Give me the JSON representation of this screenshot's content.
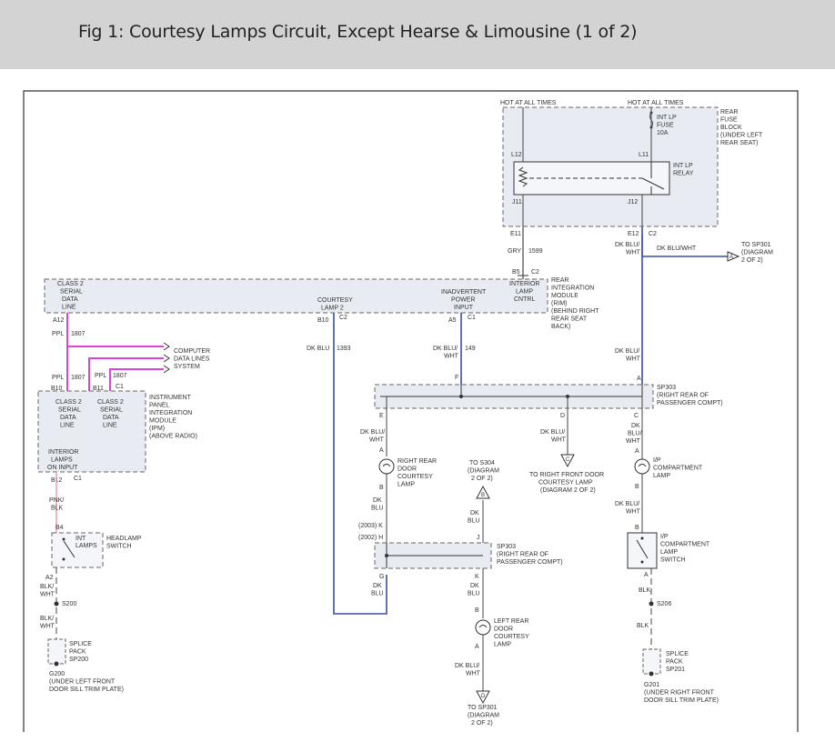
{
  "header": {
    "title": "Fig 1: Courtesy Lamps Circuit, Except Hearse & Limousine (1 of 2)"
  },
  "colors": {
    "gray_wire": "#444444",
    "blue_wire": "#3a4fa0",
    "magenta_wire": "#e040e0",
    "pink_wire": "#f0a0b0",
    "module_fill": "#e8ecf2",
    "frame": "#333333"
  },
  "fuse_block": {
    "hot_left": "HOT AT ALL TIMES",
    "hot_right": "HOT AT ALL TIMES",
    "fuse_label": [
      "INT LP",
      "FUSE",
      "10A"
    ],
    "block_label": [
      "REAR",
      "FUSE",
      "BLOCK",
      "(UNDER LEFT",
      "REAR SEAT)"
    ],
    "relay_label": [
      "INT LP",
      "RELAY"
    ],
    "pins": {
      "l12": "L12",
      "l11": "L11",
      "j11": "J11",
      "j12": "J12",
      "e11": "E11",
      "e12": "E12",
      "c2": "C2"
    }
  },
  "wires": {
    "w1599_color": "GRY",
    "w1599_num": "1599",
    "to_sp301_wire": "DK BLU/WHT",
    "to_sp301": [
      "TO SP301",
      "(DIAGRAM",
      "2 OF 2)"
    ],
    "dkbluwht_a": [
      "DK BLU/",
      "WHT"
    ],
    "w1393_color": "DK BLU",
    "w1393_num": "1393",
    "w149_color": [
      "DK BLU/",
      "WHT"
    ],
    "w149_num": "149",
    "w1807_color": "PPL",
    "w1807_num": "1807",
    "w1807b_color": "PPL",
    "w1807b_num": "1807",
    "w1807c_color": "PPL",
    "w1807c_num": "1807",
    "pnkblk": [
      "PNK/",
      "BLK"
    ],
    "blkwht1": [
      "BLK/",
      "WHT"
    ],
    "blkwht2": [
      "BLK/",
      "WHT"
    ],
    "blk1": "BLK",
    "blk2": "BLK",
    "dkblu1": [
      "DK",
      "BLU"
    ],
    "dkblu2": [
      "DK",
      "BLU"
    ],
    "dkblu3": [
      "DK",
      "BLU"
    ],
    "dkblu4": [
      "DK",
      "BLU"
    ],
    "dkbluwht_c": [
      "DK",
      "BLU/",
      "WHT"
    ],
    "dkbluwht_d": [
      "DK BLU/",
      "WHT"
    ],
    "dkbluwht_e": [
      "DK BLU/",
      "WHT"
    ],
    "dkbluwht_f": [
      "DK BLU/",
      "WHT"
    ],
    "dkbluwht_g": [
      "DK BLU/",
      "WHT"
    ]
  },
  "rim": {
    "b5": "B5",
    "c2": "C2",
    "label": [
      "REAR",
      "INTEGRATION",
      "MODULE",
      "(RIM)",
      "(BEHIND RIGHT",
      "REAR SEAT",
      "BACK)"
    ],
    "class2": [
      "CLASS 2",
      "SERIAL",
      "DATA",
      "LINE"
    ],
    "courtesy": [
      "COURTESY",
      "LAMP 2"
    ],
    "inadvertent": [
      "INADVERTENT",
      "POWER",
      "INPUT"
    ],
    "interior": [
      "INTERIOR",
      "LAMP",
      "CNTRL"
    ],
    "a12": "A12",
    "b10": "B10",
    "c2b": "C2",
    "a5": "A5",
    "c1": "C1"
  },
  "computer": [
    "COMPUTER",
    "DATA LINES",
    "SYSTEM"
  ],
  "ipm": {
    "label": [
      "INSTRUMENT",
      "PANEL",
      "INTEGRATION",
      "MODULE",
      "(IPM)",
      "(ABOVE RADIO)"
    ],
    "class2a": [
      "CLASS 2",
      "SERIAL",
      "DATA",
      "LINE"
    ],
    "class2b": [
      "CLASS 2",
      "SERIAL",
      "DATA",
      "LINE"
    ],
    "interior": [
      "INTERIOR",
      "LAMPS",
      "ON INPUT"
    ],
    "b10": "B10",
    "b11": "B11",
    "c1": "C1",
    "b12": "B12",
    "c1b": "C1"
  },
  "headlamp": {
    "label": [
      "HEADLAMP",
      "SWITCH"
    ],
    "int": [
      "INT",
      "LAMPS"
    ],
    "b4": "B4",
    "a2": "A2"
  },
  "s200": "S200",
  "s206": "S206",
  "splice200": [
    "SPLICE",
    "PACK",
    "SP200"
  ],
  "splice201": [
    "SPLICE",
    "PACK",
    "SP201"
  ],
  "g200": [
    "G200",
    "(UNDER LEFT FRONT",
    "DOOR SILL TRIM PLATE)"
  ],
  "g201": [
    "G201",
    "(UNDER RIGHT FRONT",
    "DOOR SILL TRIM PLATE)"
  ],
  "sp303_top": {
    "label": [
      "SP303",
      "(RIGHT REAR OF",
      "PASSENGER COMPT)"
    ],
    "a": "A",
    "e": "E",
    "d": "D",
    "c": "C"
  },
  "sp303_mid": {
    "label": [
      "SP303",
      "(RIGHT REAR OF",
      "PASSENGER COMPT)"
    ],
    "h": "(2002) H",
    "j": "J",
    "g": "G",
    "k": "K",
    "k2003": "(2003) K"
  },
  "rr_lamp": {
    "label": [
      "RIGHT REAR",
      "DOOR",
      "COURTESY",
      "LAMP"
    ],
    "a": "A",
    "b": "B"
  },
  "lr_lamp": {
    "label": [
      "LEFT REAR",
      "DOOR",
      "COURTESY",
      "LAMP"
    ],
    "b": "B",
    "a": "A"
  },
  "ip_lamp": {
    "label": [
      "I/P",
      "COMPARTMENT",
      "LAMP"
    ],
    "a": "A",
    "b": "B"
  },
  "ip_switch": {
    "label": [
      "I/P",
      "COMPARTMENT",
      "LAMP",
      "SWITCH"
    ],
    "b": "B",
    "a": "A"
  },
  "to_s304": {
    "text": [
      "TO S304",
      "(DIAGRAM",
      "2 OF 2)"
    ],
    "letter": "B"
  },
  "to_rf": {
    "text": [
      "TO RIGHT FRONT DOOR",
      "COURTESY LAMP",
      "(DIAGRAM 2 OF 2)"
    ],
    "letter": "C"
  },
  "to_sp301b": {
    "text": [
      "TO SP301",
      "(DIAGRAM",
      "2 OF 2)"
    ],
    "letter": "D"
  },
  "conn_a": "A"
}
